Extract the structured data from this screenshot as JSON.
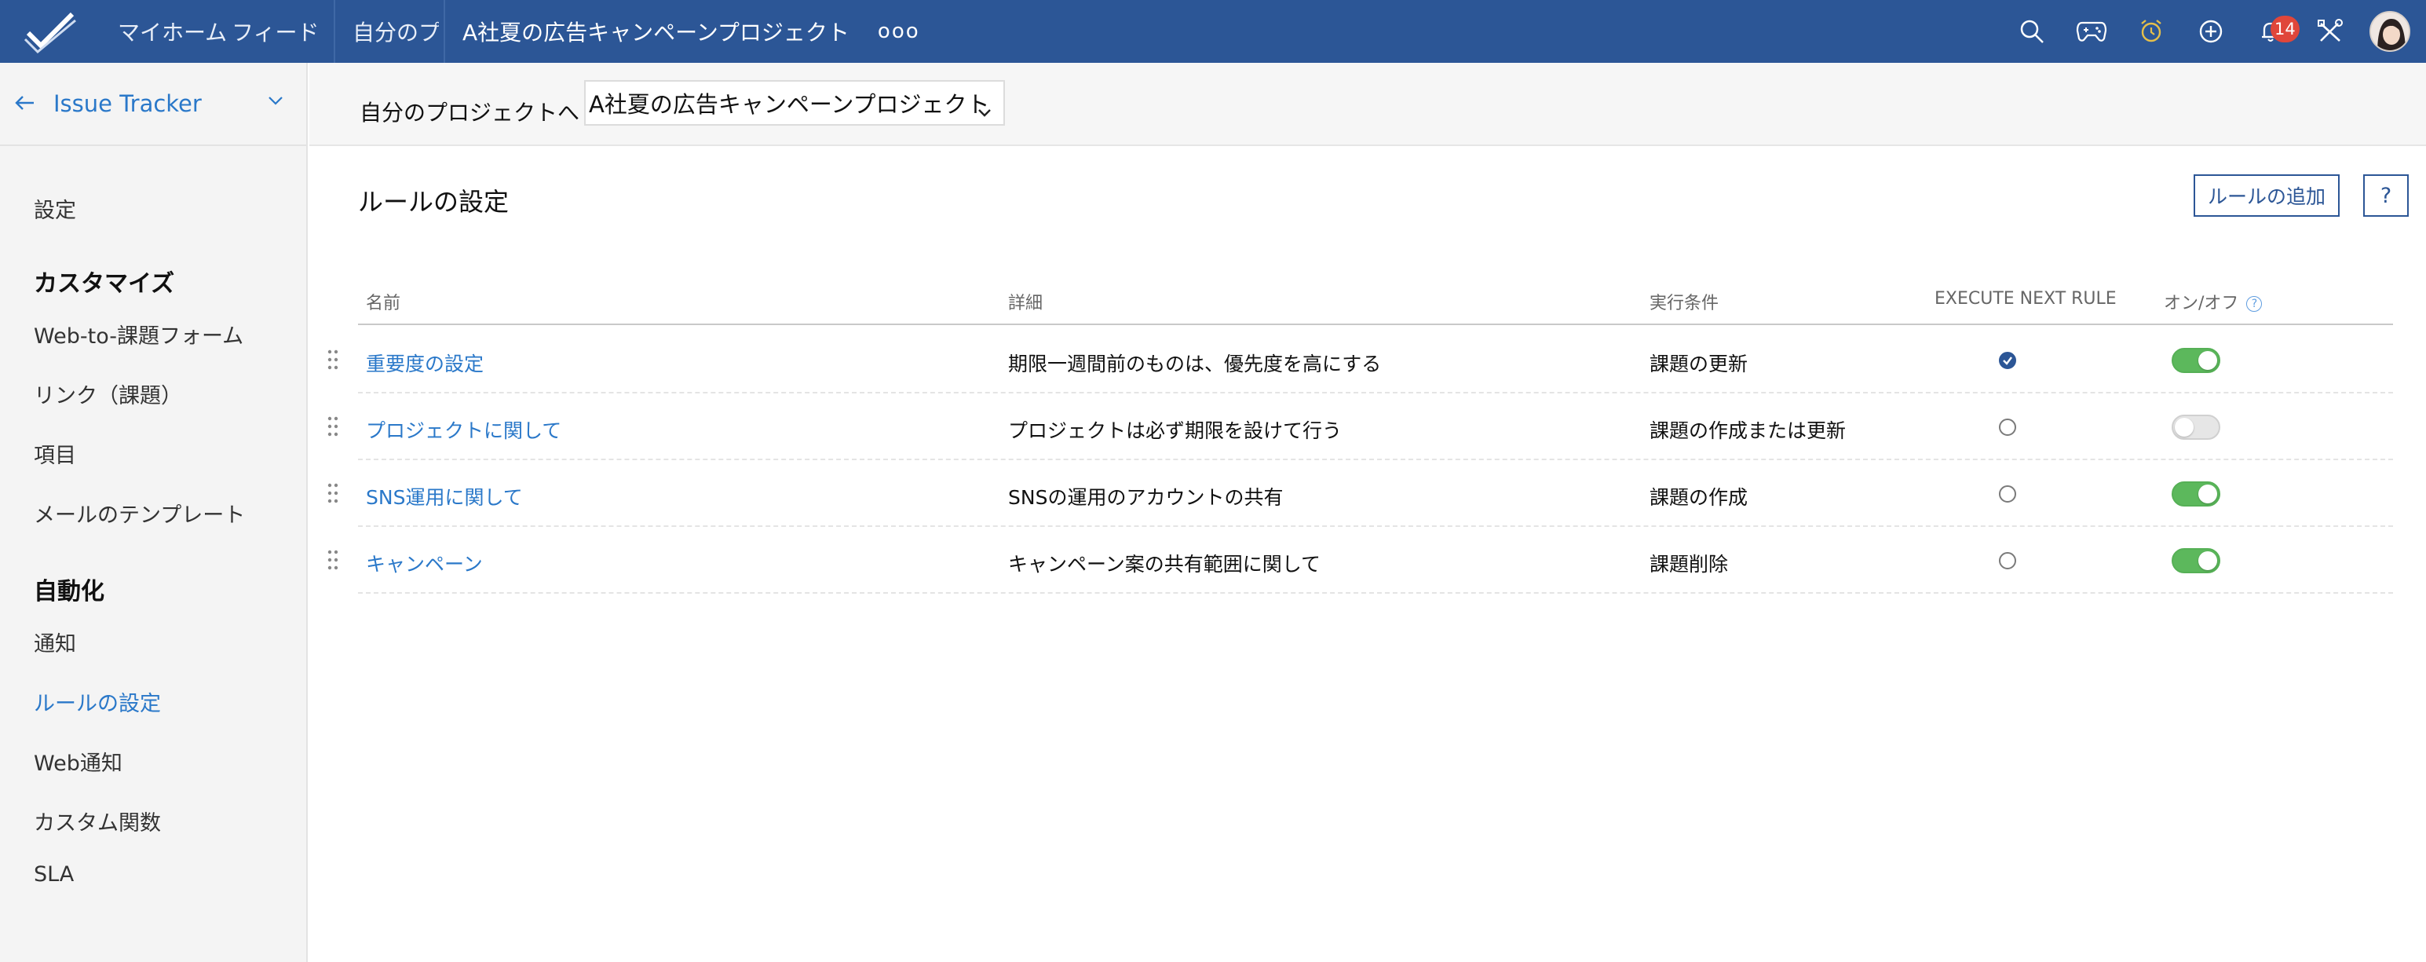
{
  "topbar": {
    "home": "マイホーム",
    "feed": "フィード",
    "projects": "自分のプロジェクト",
    "current_project": "A社夏の広告キャンペーンプロジェクト",
    "more": "ooo",
    "notification_count": "14",
    "icons": [
      "search-icon",
      "gamepad-icon",
      "alarm-clock-icon",
      "add-circle-icon",
      "bell-icon",
      "tools-icon"
    ]
  },
  "sidebar": {
    "header": "Issue Tracker",
    "items": [
      {
        "label": "設定",
        "type": "item"
      },
      {
        "label": "カスタマイズ",
        "type": "section"
      },
      {
        "label": "Web-to-課題フォーム",
        "type": "item"
      },
      {
        "label": "リンク（課題）",
        "type": "item"
      },
      {
        "label": "項目",
        "type": "item"
      },
      {
        "label": "メールのテンプレート",
        "type": "item"
      },
      {
        "label": "自動化",
        "type": "section"
      },
      {
        "label": "通知",
        "type": "item"
      },
      {
        "label": "ルールの設定",
        "type": "item",
        "active": true
      },
      {
        "label": "Web通知",
        "type": "item"
      },
      {
        "label": "カスタム関数",
        "type": "item"
      },
      {
        "label": "SLA",
        "type": "item"
      }
    ]
  },
  "subheader": {
    "label": "自分のプロジェクトへ",
    "selected_project": "A社夏の広告キャンペーンプロジェクト"
  },
  "main": {
    "title": "ルールの設定",
    "add_button": "ルールの追加",
    "help_button": "?",
    "columns": {
      "name": "名前",
      "detail": "詳細",
      "condition": "実行条件",
      "execute_next": "EXECUTE NEXT RULE",
      "onoff": "オン/オフ",
      "onoff_help": "?"
    },
    "rows": [
      {
        "name": "重要度の設定",
        "detail": "期限一週間前のものは、優先度を高にする",
        "condition": "課題の更新",
        "execute_next": true,
        "enabled": true
      },
      {
        "name": "プロジェクトに関して",
        "detail": "プロジェクトは必ず期限を設けて行う",
        "condition": "課題の作成または更新",
        "execute_next": false,
        "enabled": false
      },
      {
        "name": "SNS運用に関して",
        "detail": "SNSの運用のアカウントの共有",
        "condition": "課題の作成",
        "execute_next": false,
        "enabled": true
      },
      {
        "name": "キャンペーン",
        "detail": "キャンペーン案の共有範囲に関して",
        "condition": "課題削除",
        "execute_next": false,
        "enabled": true
      }
    ]
  },
  "colors": {
    "topbar": "#2c5696",
    "link": "#2a78c9",
    "toggle_on": "#5cb85c",
    "badge": "#e0463a"
  }
}
